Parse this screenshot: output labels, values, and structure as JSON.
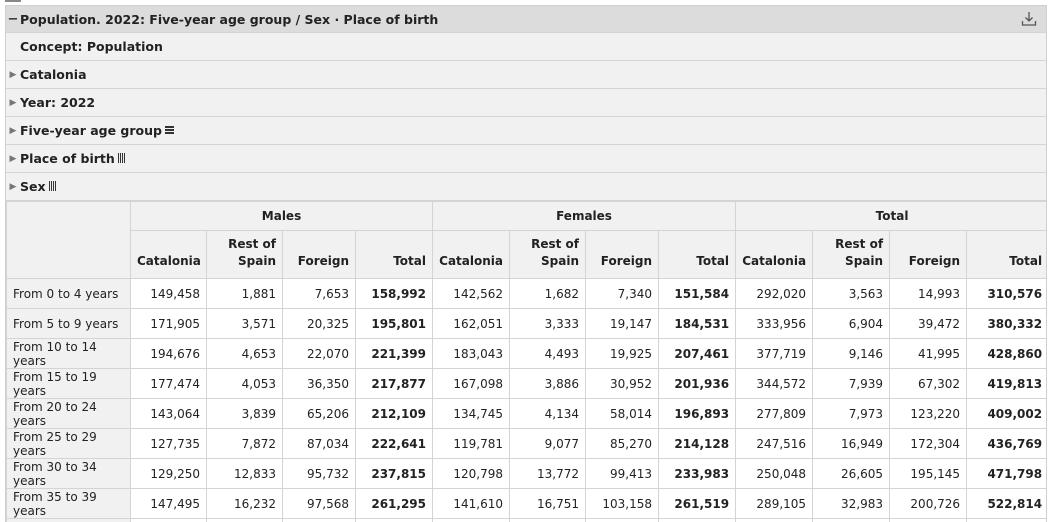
{
  "panel": {
    "title": "Population. 2022: Five-year age group / Sex · Place of birth",
    "concept": "Concept: Population",
    "filters": [
      "Catalonia",
      "Year: 2022",
      "Five-year age group",
      "Place of birth",
      "Sex"
    ]
  },
  "table": {
    "groups": [
      "Males",
      "Females",
      "Total"
    ],
    "subheaders": [
      "Catalonia",
      "Rest of\nSpain",
      "Foreign",
      "Total"
    ],
    "rows": [
      {
        "label": "From 0 to 4 years",
        "values": [
          "149,458",
          "1,881",
          "7,653",
          "158,992",
          "142,562",
          "1,682",
          "7,340",
          "151,584",
          "292,020",
          "3,563",
          "14,993",
          "310,576"
        ]
      },
      {
        "label": "From 5 to 9 years",
        "values": [
          "171,905",
          "3,571",
          "20,325",
          "195,801",
          "162,051",
          "3,333",
          "19,147",
          "184,531",
          "333,956",
          "6,904",
          "39,472",
          "380,332"
        ]
      },
      {
        "label": "From 10 to 14 years",
        "values": [
          "194,676",
          "4,653",
          "22,070",
          "221,399",
          "183,043",
          "4,493",
          "19,925",
          "207,461",
          "377,719",
          "9,146",
          "41,995",
          "428,860"
        ]
      },
      {
        "label": "From 15 to 19 years",
        "values": [
          "177,474",
          "4,053",
          "36,350",
          "217,877",
          "167,098",
          "3,886",
          "30,952",
          "201,936",
          "344,572",
          "7,939",
          "67,302",
          "419,813"
        ]
      },
      {
        "label": "From 20 to 24 years",
        "values": [
          "143,064",
          "3,839",
          "65,206",
          "212,109",
          "134,745",
          "4,134",
          "58,014",
          "196,893",
          "277,809",
          "7,973",
          "123,220",
          "409,002"
        ]
      },
      {
        "label": "From 25 to 29 years",
        "values": [
          "127,735",
          "7,872",
          "87,034",
          "222,641",
          "119,781",
          "9,077",
          "85,270",
          "214,128",
          "247,516",
          "16,949",
          "172,304",
          "436,769"
        ]
      },
      {
        "label": "From 30 to 34 years",
        "values": [
          "129,250",
          "12,833",
          "95,732",
          "237,815",
          "120,798",
          "13,772",
          "99,413",
          "233,983",
          "250,048",
          "26,605",
          "195,145",
          "471,798"
        ]
      },
      {
        "label": "From 35 to 39 years",
        "values": [
          "147,495",
          "16,232",
          "97,568",
          "261,295",
          "141,610",
          "16,751",
          "103,158",
          "261,519",
          "289,105",
          "32,983",
          "200,726",
          "522,814"
        ]
      }
    ]
  },
  "colors": {
    "header_bg": "#dcdcdc",
    "row_bg": "#f1f1f1",
    "border": "#d4d4d4"
  },
  "icons": {
    "download": "download-icon",
    "collapse": "minus-icon",
    "expand": "triangle-right-icon"
  }
}
